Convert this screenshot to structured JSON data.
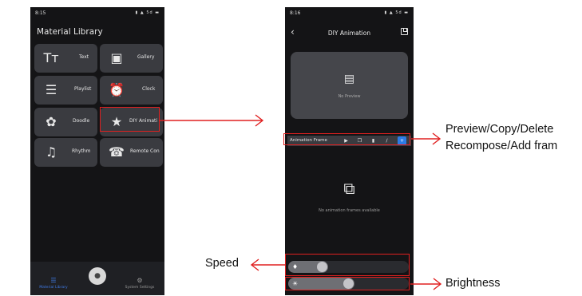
{
  "left_screen": {
    "status_time": "8:15",
    "status_icons": "▮ ▲ 5d ▬",
    "title": "Material Library",
    "tiles": [
      {
        "label": "Text",
        "icon": "text-icon",
        "glyph": "Tᴛ"
      },
      {
        "label": "Gallery",
        "icon": "gallery-icon",
        "glyph": "▣"
      },
      {
        "label": "Playlist",
        "icon": "playlist-icon",
        "glyph": "☰"
      },
      {
        "label": "Clock",
        "icon": "clock-icon",
        "glyph": "⏰"
      },
      {
        "label": "Doodle",
        "icon": "palette-icon",
        "glyph": "✿"
      },
      {
        "label": "DIY Animati",
        "icon": "star-sparkle-icon",
        "glyph": "★"
      },
      {
        "label": "Rhythm",
        "icon": "music-icon",
        "glyph": "♫"
      },
      {
        "label": "Remote Con",
        "icon": "remote-icon",
        "glyph": "☎"
      }
    ],
    "bottom_nav": {
      "left_label": "Material Library",
      "left_icon": "menu-icon",
      "center_icon": "home-icon",
      "right_label": "System Settings",
      "right_icon": "gear-icon",
      "active_color": "#3f7be8"
    }
  },
  "right_screen": {
    "status_time": "8:16",
    "status_icons": "▮ ▲ 5d ▬",
    "back_icon": "chevron-left-icon",
    "back_glyph": "‹",
    "title": "DIY Animation",
    "save_icon": "save-icon",
    "preview": {
      "icon": "clapperboard-icon",
      "glyph": "🎬",
      "text": "No Preview"
    },
    "frame_toolbar": {
      "label": "Animation Frame",
      "buttons": [
        {
          "name": "play-icon",
          "glyph": "▶"
        },
        {
          "name": "copy-icon",
          "glyph": "❐"
        },
        {
          "name": "delete-icon",
          "glyph": "▮"
        },
        {
          "name": "edit-icon",
          "glyph": "∕"
        },
        {
          "name": "add-icon",
          "glyph": "+"
        }
      ],
      "add_color": "#2c7be5"
    },
    "empty_state": {
      "icon": "frames-icon",
      "glyph": "⧉",
      "text": "No animation frames available"
    },
    "speed_slider": {
      "icon": "speed-icon",
      "glyph": "♦",
      "value": 0.33
    },
    "brightness_slider": {
      "icon": "brightness-icon",
      "glyph": "☀",
      "value": 0.55
    }
  },
  "annotations": {
    "controls_line1": "Preview/Copy/Delete",
    "controls_line2": "Recompose/Add fram",
    "speed": "Speed",
    "brightness": "Brightness",
    "highlight_color": "#e02020"
  }
}
